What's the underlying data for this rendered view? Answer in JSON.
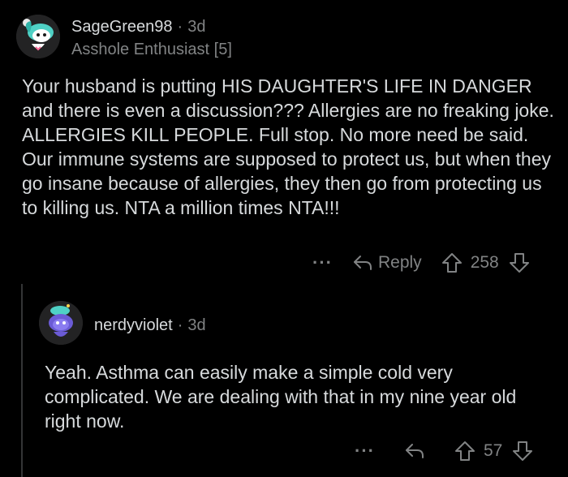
{
  "comment1": {
    "username": "SageGreen98",
    "separator": "·",
    "time": "3d",
    "flair": "Asshole Enthusiast [5]",
    "body": "Your husband is putting HIS DAUGHTER'S LIFE IN DANGER and there is even a discussion??? Allergies are no freaking joke. ALLERGIES KILL PEOPLE. Full stop. No more need be said. Our immune systems are supposed to protect us, but when they go insane because of allergies, they then go from protecting us to killing us. NTA a million times NTA!!!",
    "more_label": "···",
    "reply_label": "Reply",
    "score": "258",
    "icons": {
      "reply": "reply-arrow-icon",
      "upvote": "upvote-arrow-icon",
      "downvote": "downvote-arrow-icon"
    }
  },
  "comment2": {
    "username": "nerdyviolet",
    "separator": "·",
    "time": "3d",
    "body": "Yeah. Asthma can easily make a simple cold very complicated. We are dealing with that in my nine year old right now.",
    "more_label": "···",
    "score": "57",
    "icons": {
      "reply": "reply-arrow-icon",
      "upvote": "upvote-arrow-icon",
      "downvote": "downvote-arrow-icon"
    }
  },
  "colors": {
    "background": "#000000",
    "text": "#d7dadc",
    "muted": "#818384",
    "thread_line": "#343536"
  }
}
